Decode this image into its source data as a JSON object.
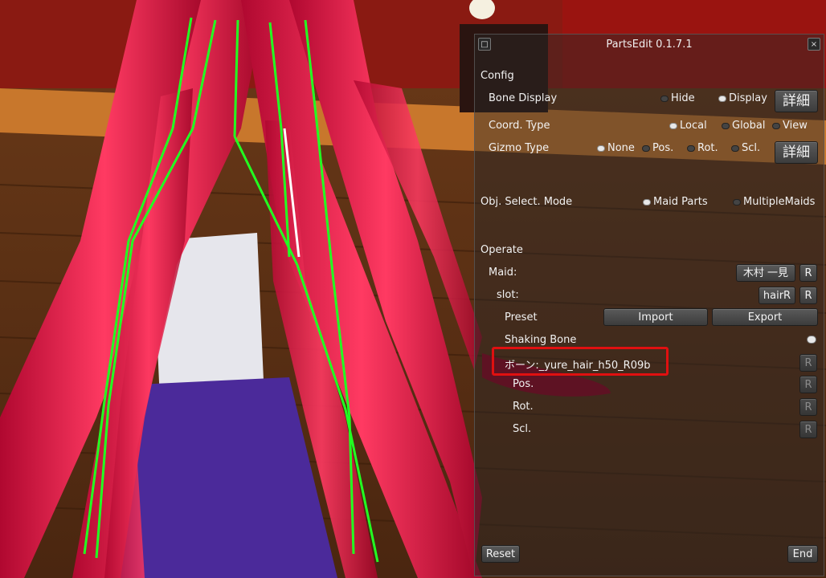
{
  "window": {
    "title": "PartsEdit 0.1.7.1",
    "left_button": "□",
    "close_button": "×"
  },
  "config": {
    "header": "Config",
    "bone_display": {
      "label": "Bone Display",
      "options": [
        "Hide",
        "Display"
      ],
      "selected": "Display",
      "detail": "詳細"
    },
    "coord_type": {
      "label": "Coord. Type",
      "options": [
        "Local",
        "Global",
        "View"
      ],
      "selected": "Local"
    },
    "gizmo_type": {
      "label": "Gizmo Type",
      "options": [
        "None",
        "Pos.",
        "Rot.",
        "Scl."
      ],
      "selected": "None",
      "detail": "詳細"
    }
  },
  "obj_select": {
    "label": "Obj. Select. Mode",
    "options": [
      "Maid Parts",
      "MultipleMaids"
    ],
    "selected": "Maid Parts"
  },
  "operate": {
    "header": "Operate",
    "maid": {
      "label": "Maid:",
      "value": "木村 一見",
      "reset": "R"
    },
    "slot": {
      "label": "slot:",
      "value": "hairR",
      "reset": "R"
    },
    "preset": {
      "label": "Preset",
      "import": "Import",
      "export": "Export"
    },
    "shaking_bone": {
      "label": "Shaking Bone"
    },
    "bone": {
      "label": "ボーン:_yure_hair_h50_R09b",
      "reset": "R"
    },
    "pos": {
      "label": "Pos.",
      "reset": "R"
    },
    "rot": {
      "label": "Rot.",
      "reset": "R"
    },
    "scl": {
      "label": "Scl.",
      "reset": "R"
    }
  },
  "footer": {
    "reset": "Reset",
    "end": "End"
  },
  "colors": {
    "hair": "#d4103a",
    "bone": "#22ff22",
    "highlight": "#e01010"
  }
}
